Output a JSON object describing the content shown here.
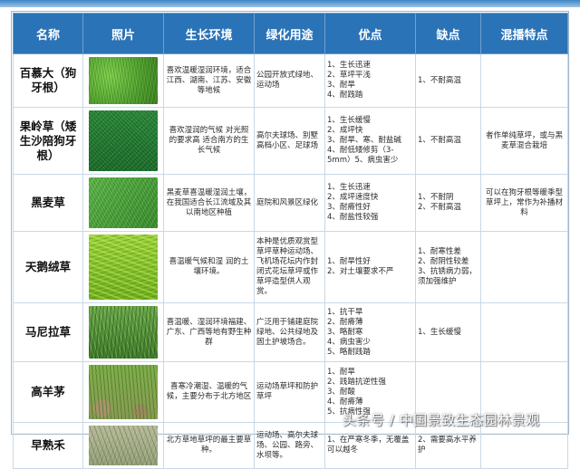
{
  "headers": [
    "名称",
    "照片",
    "生长环境",
    "绿化用途",
    "优点",
    "缺点",
    "混播特点"
  ],
  "rows": [
    {
      "name": "百慕大（狗牙根）",
      "photo_icon": "grass-photo-bermuda",
      "environment": "喜欢温暖湿润环境，适合江西、湖南、江苏、安徽等地候",
      "usage": "公园开放式绿地、运动场",
      "pros": [
        "1、生长迅速",
        "2、草坪平浅",
        "3、耐旱",
        "4、耐践踏"
      ],
      "cons": [
        "1、不耐高温"
      ],
      "sowing": ""
    },
    {
      "name": "果岭草（矮生沙陪狗牙根）",
      "photo_icon": "grass-photo-tifdwarf",
      "environment": "喜欢湿润的气候 对光照的要求高 适合南方的生长气候",
      "usage": "高尔夫球场、别墅高档小区、足球场",
      "pros": [
        "1、生长缓慢",
        "2、成坪快",
        "3、耐旱、寒、耐盐碱",
        "4、耐低矮修剪（3-5mm）5、病虫害少"
      ],
      "cons": [
        "1、不耐高温"
      ],
      "sowing": "者作单纯草坪，或与黑麦草混合栽培"
    },
    {
      "name": "黑麦草",
      "photo_icon": "grass-photo-ryegrass",
      "environment": "黑麦草喜温暖湿润土壤，在我国适合长江流域及其以南地区种植",
      "usage": "庭院和风景区绿化",
      "pros": [
        "1、生长迅速",
        "2、成坪速度快",
        "3、耐瘠性好",
        "4、耐盐性较强"
      ],
      "cons": [
        "1、不耐阴",
        "2、不耐高温"
      ],
      "sowing": "可以在狗牙根等暖季型草坪上，常作为补播材料"
    },
    {
      "name": "天鹅绒草",
      "photo_icon": "grass-photo-velvet",
      "environment": "喜温暖气候和湿 润的土壤环境。",
      "usage": "本种是优质观赏型草坪草种运动场、飞机场花坛内作封闭式花坛草坪或作草坪造型供人观赏。",
      "pros": [
        "1、耐旱性好",
        "2、对土壤要求不严"
      ],
      "cons": [
        "1、耐寒性差",
        "2、耐阴性较差",
        "3、抗锈病力弱，须加强维护"
      ],
      "sowing": ""
    },
    {
      "name": "马尼拉草",
      "photo_icon": "grass-photo-manila",
      "environment": "喜温暖、湿润环境福建、广东、广西等地有野生种群",
      "usage": "广泛用于铺建庭院绿地、公共绿地及固土护坡场合。",
      "pros": [
        "1、抗干旱",
        "2、耐瘠薄",
        "3、略耐寒",
        "4、病虫害少",
        "5、略耐践踏"
      ],
      "cons": [
        "1、生长缓慢"
      ],
      "sowing": ""
    },
    {
      "name": "高羊茅",
      "photo_icon": "grass-photo-tall-fescue",
      "environment": "喜寒冷潮湿、温暖的气候，主要分布于北方地区",
      "usage": "运动场草坪和防护草坪",
      "pros": [
        "1、耐旱",
        "2、践踏抗逆性强",
        "3、耐酸",
        "4、耐瘠薄",
        "5、抗病性强"
      ],
      "cons": [],
      "sowing": ""
    },
    {
      "name": "早熟禾",
      "photo_icon": "grass-photo-bluegrass",
      "environment": "北方草地草坪的最主要草种。",
      "usage": "运动场、高尔夫球场、公园、路旁、水坝等。",
      "pros": [
        "1、在严寒冬季，无覆盖可以越冬"
      ],
      "cons": [
        "2、需要高水平养护"
      ],
      "sowing": ""
    }
  ],
  "watermark": "头条号 / 中国景致生态园林景观"
}
